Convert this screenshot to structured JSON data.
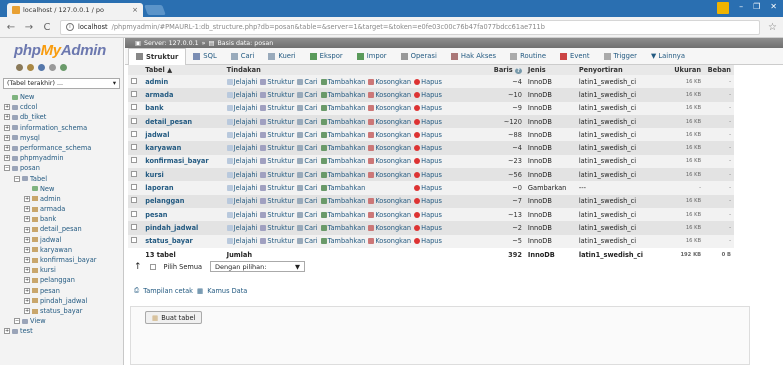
{
  "browser": {
    "tab_title": "localhost / 127.0.0.1 / po",
    "tab_close": "×",
    "url_host": "localhost",
    "url_path": "/phpmyadmin/#PMAURL-1:db_structure.php?db=posan&table=&server=1&target=&token=e0fe03c00c76b47fa077bdcc61ae711b",
    "back": "←",
    "forward": "→",
    "reload": "C",
    "info": "i",
    "star": "☆",
    "minimize": "–",
    "maximize": "❐",
    "close": "✕"
  },
  "sidebar": {
    "logo_php": "php",
    "logo_my": "My",
    "logo_admin": "Admin",
    "recent_label": "(Tabel terakhir) ...",
    "tree": [
      {
        "label": "New",
        "indent": 0,
        "kind": "new"
      },
      {
        "label": "cdcol",
        "indent": 0,
        "kind": "db"
      },
      {
        "label": "db_tiket",
        "indent": 0,
        "kind": "db"
      },
      {
        "label": "information_schema",
        "indent": 0,
        "kind": "db"
      },
      {
        "label": "mysql",
        "indent": 0,
        "kind": "db"
      },
      {
        "label": "performance_schema",
        "indent": 0,
        "kind": "db"
      },
      {
        "label": "phpmyadmin",
        "indent": 0,
        "kind": "db"
      },
      {
        "label": "posan",
        "indent": 0,
        "kind": "db-open"
      },
      {
        "label": "Tabel",
        "indent": 1,
        "kind": "group"
      },
      {
        "label": "New",
        "indent": 2,
        "kind": "new"
      },
      {
        "label": "admin",
        "indent": 2,
        "kind": "table"
      },
      {
        "label": "armada",
        "indent": 2,
        "kind": "table"
      },
      {
        "label": "bank",
        "indent": 2,
        "kind": "table"
      },
      {
        "label": "detail_pesan",
        "indent": 2,
        "kind": "table"
      },
      {
        "label": "jadwal",
        "indent": 2,
        "kind": "table"
      },
      {
        "label": "karyawan",
        "indent": 2,
        "kind": "table"
      },
      {
        "label": "konfirmasi_bayar",
        "indent": 2,
        "kind": "table"
      },
      {
        "label": "kursi",
        "indent": 2,
        "kind": "table"
      },
      {
        "label": "pelanggan",
        "indent": 2,
        "kind": "table"
      },
      {
        "label": "pesan",
        "indent": 2,
        "kind": "table"
      },
      {
        "label": "pindah_jadwal",
        "indent": 2,
        "kind": "table"
      },
      {
        "label": "status_bayar",
        "indent": 2,
        "kind": "table"
      },
      {
        "label": "View",
        "indent": 1,
        "kind": "group"
      },
      {
        "label": "test",
        "indent": 0,
        "kind": "db"
      }
    ]
  },
  "breadcrumb": {
    "server": "Server: 127.0.0.1",
    "sep": "»",
    "database": "Basis data: posan"
  },
  "tabs": [
    {
      "label": "Struktur",
      "active": true,
      "color": "#888"
    },
    {
      "label": "SQL",
      "active": false,
      "color": "#7a8db3"
    },
    {
      "label": "Cari",
      "active": false,
      "color": "#9ab"
    },
    {
      "label": "Kueri",
      "active": false,
      "color": "#9ab"
    },
    {
      "label": "Ekspor",
      "active": false,
      "color": "#5a9a5a"
    },
    {
      "label": "Impor",
      "active": false,
      "color": "#5a9a5a"
    },
    {
      "label": "Operasi",
      "active": false,
      "color": "#999"
    },
    {
      "label": "Hak Akses",
      "active": false,
      "color": "#a77"
    },
    {
      "label": "Routine",
      "active": false,
      "color": "#aaa"
    },
    {
      "label": "Event",
      "active": false,
      "color": "#c44"
    },
    {
      "label": "Trigger",
      "active": false,
      "color": "#aaa"
    },
    {
      "label": "▼ Lainnya",
      "active": false,
      "color": null
    }
  ],
  "table_headers": {
    "name": "Tabel",
    "sort": "▲",
    "actions": "Tindakan",
    "rows": "Baris",
    "rows_help": "?",
    "type": "Jenis",
    "collation": "Penyortiran",
    "size": "Ukuran",
    "overhead": "Beban"
  },
  "action_labels": {
    "browse": "Jelajahi",
    "structure": "Struktur",
    "search": "Cari",
    "insert": "Tambahkan",
    "empty": "Kosongkan",
    "drop": "Hapus"
  },
  "tables": [
    {
      "name": "admin",
      "rows": "~4",
      "type": "InnoDB",
      "collation": "latin1_swedish_ci",
      "size": "16 KB",
      "overhead": "-",
      "view": false
    },
    {
      "name": "armada",
      "rows": "~10",
      "type": "InnoDB",
      "collation": "latin1_swedish_ci",
      "size": "16 KB",
      "overhead": "-",
      "view": false
    },
    {
      "name": "bank",
      "rows": "~9",
      "type": "InnoDB",
      "collation": "latin1_swedish_ci",
      "size": "16 KB",
      "overhead": "-",
      "view": false
    },
    {
      "name": "detail_pesan",
      "rows": "~120",
      "type": "InnoDB",
      "collation": "latin1_swedish_ci",
      "size": "16 KB",
      "overhead": "-",
      "view": false
    },
    {
      "name": "jadwal",
      "rows": "~88",
      "type": "InnoDB",
      "collation": "latin1_swedish_ci",
      "size": "16 KB",
      "overhead": "-",
      "view": false
    },
    {
      "name": "karyawan",
      "rows": "~4",
      "type": "InnoDB",
      "collation": "latin1_swedish_ci",
      "size": "16 KB",
      "overhead": "-",
      "view": false
    },
    {
      "name": "konfirmasi_bayar",
      "rows": "~23",
      "type": "InnoDB",
      "collation": "latin1_swedish_ci",
      "size": "16 KB",
      "overhead": "-",
      "view": false
    },
    {
      "name": "kursi",
      "rows": "~56",
      "type": "InnoDB",
      "collation": "latin1_swedish_ci",
      "size": "16 KB",
      "overhead": "-",
      "view": false
    },
    {
      "name": "laporan",
      "rows": "~0",
      "type": "Gambarkan",
      "collation": "---",
      "size": "-",
      "overhead": "-",
      "view": true
    },
    {
      "name": "pelanggan",
      "rows": "~7",
      "type": "InnoDB",
      "collation": "latin1_swedish_ci",
      "size": "16 KB",
      "overhead": "-",
      "view": false
    },
    {
      "name": "pesan",
      "rows": "~13",
      "type": "InnoDB",
      "collation": "latin1_swedish_ci",
      "size": "16 KB",
      "overhead": "-",
      "view": false
    },
    {
      "name": "pindah_jadwal",
      "rows": "~2",
      "type": "InnoDB",
      "collation": "latin1_swedish_ci",
      "size": "16 KB",
      "overhead": "-",
      "view": false
    },
    {
      "name": "status_bayar",
      "rows": "~5",
      "type": "InnoDB",
      "collation": "latin1_swedish_ci",
      "size": "16 KB",
      "overhead": "-",
      "view": false
    }
  ],
  "summary": {
    "count": "13 tabel",
    "label": "Jumlah",
    "rows": "392",
    "type": "InnoDB",
    "collation": "latin1_swedish_ci",
    "size": "192 KB",
    "overhead": "0 B"
  },
  "bulk": {
    "arrow": "↑",
    "check_all": "Pilih Semua",
    "with_selected": "Dengan pilihan:",
    "caret": "▼"
  },
  "links": {
    "print": "Tampilan cetak",
    "dictionary": "Kamus Data"
  },
  "create": {
    "button": "Buat tabel"
  },
  "colors": {
    "chrome_blue": "#2a6fb1",
    "link": "#235a81",
    "drop_red": "#d33",
    "logo_orange": "#f89c0e",
    "logo_blue": "#6c78af"
  }
}
